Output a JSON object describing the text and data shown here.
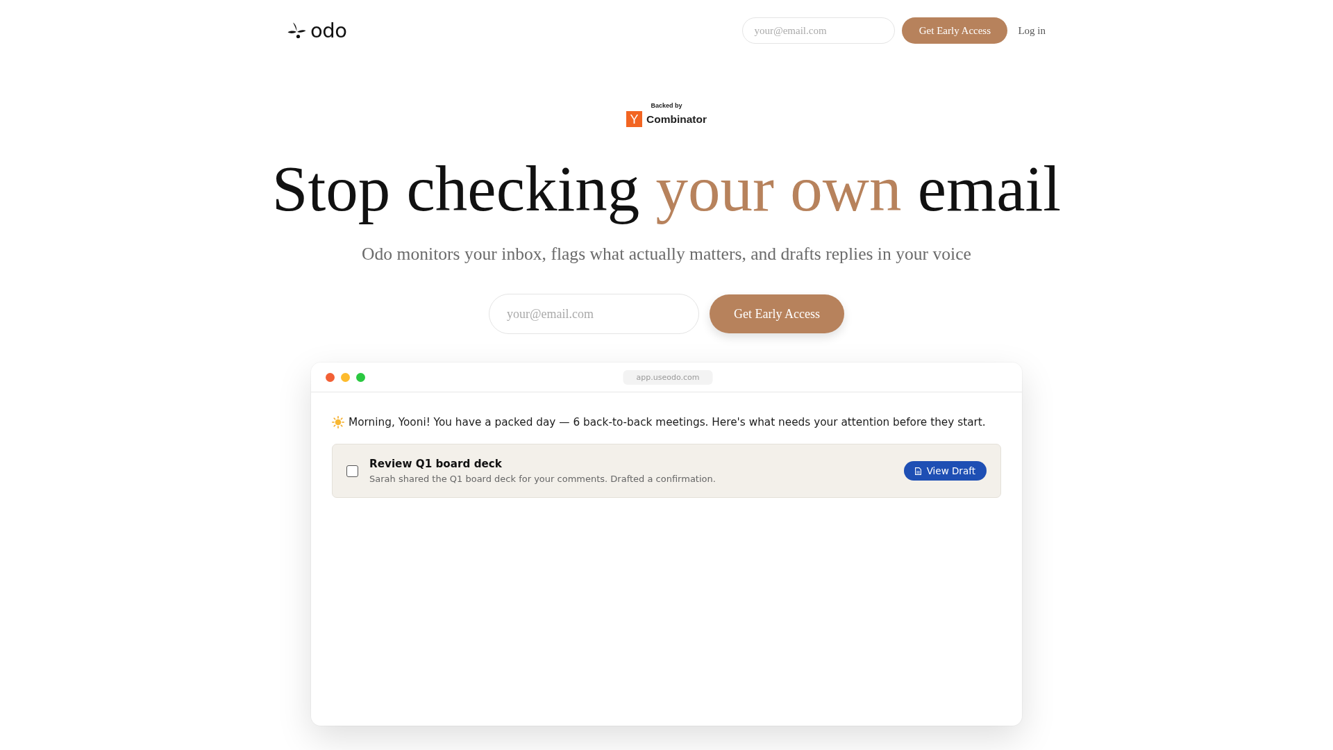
{
  "header": {
    "logo": "odo",
    "email_field": {
      "placeholder": "your@email.com"
    },
    "cta": "Get Early Access",
    "login": "Log in"
  },
  "badge": {
    "caption": "Backed by",
    "mark": "Y",
    "name": "Combinator"
  },
  "hero": {
    "headline": [
      {
        "text": "Stop checking ",
        "accent": false
      },
      {
        "text": "your own",
        "accent": true
      },
      {
        "text": " email",
        "accent": false
      }
    ],
    "subtitle": "Odo monitors your inbox, flags what actually matters, and drafts replies in your voice",
    "email_field": {
      "placeholder": "your@email.com"
    },
    "cta": "Get Early Access"
  },
  "app_window": {
    "window_buttons": [
      {
        "color": "#f26035"
      },
      {
        "color": "#fdbb2d"
      },
      {
        "color": "#2ac840"
      }
    ],
    "url": "app.useodo.com",
    "greeting": "Morning, Yooni! You have a packed day — 6 back-to-back meetings. Here's what needs your attention before they start.",
    "tasks": [
      {
        "title": "Review Q1 board deck",
        "description": "Sarah shared the Q1 board deck for your comments. Drafted a confirmation.",
        "checked": false,
        "action": "View Draft"
      }
    ]
  }
}
